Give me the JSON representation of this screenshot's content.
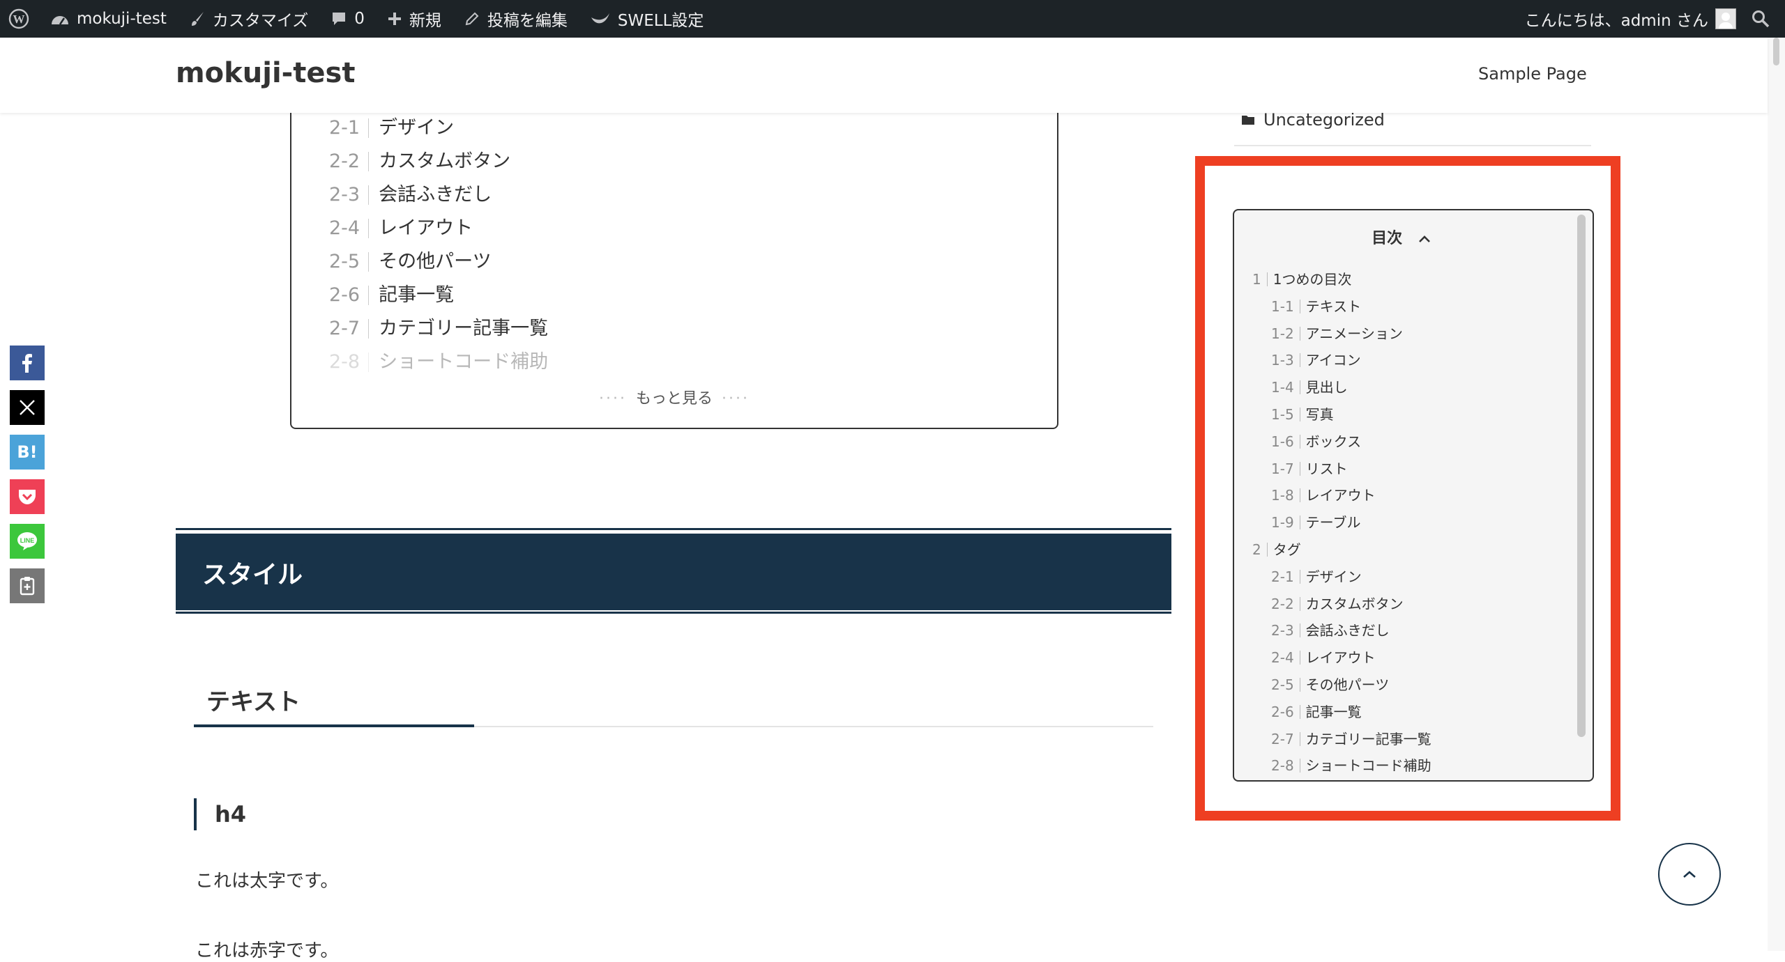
{
  "adminbar": {
    "site_name": "mokuji-test",
    "customize": "カスタマイズ",
    "comments_count": "0",
    "new": "新規",
    "edit_post": "投稿を編集",
    "swell_settings": "SWELL設定",
    "greeting": "こんにちは、admin さん"
  },
  "header": {
    "site_title": "mokuji-test",
    "nav_item": "Sample Page"
  },
  "content_toc": {
    "items": [
      {
        "num": "2-1",
        "label": "デザイン"
      },
      {
        "num": "2-2",
        "label": "カスタムボタン"
      },
      {
        "num": "2-3",
        "label": "会話ふきだし"
      },
      {
        "num": "2-4",
        "label": "レイアウト"
      },
      {
        "num": "2-5",
        "label": "その他パーツ"
      },
      {
        "num": "2-6",
        "label": "記事一覧"
      },
      {
        "num": "2-7",
        "label": "カテゴリー記事一覧"
      },
      {
        "num": "2-8",
        "label": "ショートコード補助"
      }
    ],
    "more_dots": "····",
    "more_label": "もっと見る"
  },
  "article": {
    "h2": "スタイル",
    "h3": "テキスト",
    "h4": "h4",
    "p1": "これは太字です。",
    "p2": "これは赤字です。"
  },
  "sidebar": {
    "category": "Uncategorized",
    "toc_title": "目次",
    "toc_items": [
      {
        "num": "1",
        "label": "1つめの目次"
      },
      {
        "num": "1-1",
        "label": "テキスト"
      },
      {
        "num": "1-2",
        "label": "アニメーション"
      },
      {
        "num": "1-3",
        "label": "アイコン"
      },
      {
        "num": "1-4",
        "label": "見出し"
      },
      {
        "num": "1-5",
        "label": "写真"
      },
      {
        "num": "1-6",
        "label": "ボックス"
      },
      {
        "num": "1-7",
        "label": "リスト"
      },
      {
        "num": "1-8",
        "label": "レイアウト"
      },
      {
        "num": "1-9",
        "label": "テーブル"
      },
      {
        "num": "2",
        "label": "タグ"
      },
      {
        "num": "2-1",
        "label": "デザイン"
      },
      {
        "num": "2-2",
        "label": "カスタムボタン"
      },
      {
        "num": "2-3",
        "label": "会話ふきだし"
      },
      {
        "num": "2-4",
        "label": "レイアウト"
      },
      {
        "num": "2-5",
        "label": "その他パーツ"
      },
      {
        "num": "2-6",
        "label": "記事一覧"
      },
      {
        "num": "2-7",
        "label": "カテゴリー記事一覧"
      },
      {
        "num": "2-8",
        "label": "ショートコード補助"
      }
    ]
  },
  "share": {
    "icons": [
      "facebook-icon",
      "x-icon",
      "hatena-icon",
      "pocket-icon",
      "line-icon",
      "copy-icon"
    ],
    "hatena_text": "B!"
  },
  "colors": {
    "admin_bar": "#1d2327",
    "accent_navy": "#183349",
    "highlight_red": "#ee3f22",
    "facebook": "#3b5998",
    "x": "#000000",
    "hatena": "#4ba3d9",
    "pocket": "#ef4056",
    "line": "#3cc73c",
    "copy": "#777777"
  }
}
